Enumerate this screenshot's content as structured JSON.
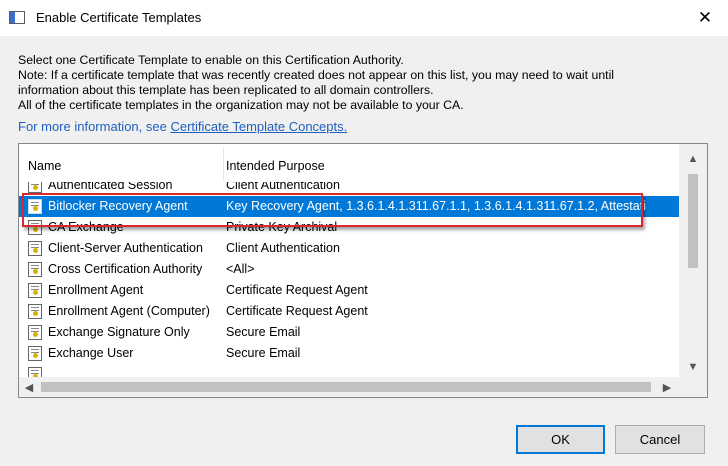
{
  "window": {
    "title": "Enable Certificate Templates",
    "close_glyph": "✕"
  },
  "description": {
    "line1": "Select one Certificate Template to enable on this Certification Authority.",
    "line2": "Note: If a certificate template that was recently created does not appear on this list, you may need to wait until",
    "line3": "information about this template has been replicated to all domain controllers.",
    "line4": "All of the certificate templates in the organization may not be available to your CA.",
    "info_prefix": "For more information, see ",
    "info_link": "Certificate Template Concepts."
  },
  "list": {
    "columns": {
      "name": "Name",
      "purpose": "Intended Purpose"
    },
    "rows": [
      {
        "name": "Authenticated Session",
        "purpose": "Client Authentication"
      },
      {
        "name": "Bitlocker Recovery Agent",
        "purpose": "Key Recovery Agent, 1.3.6.1.4.1.311.67.1.1, 1.3.6.1.4.1.311.67.1.2, Attestati"
      },
      {
        "name": "CA Exchange",
        "purpose": "Private Key Archival"
      },
      {
        "name": "Client-Server Authentication",
        "purpose": "Client Authentication"
      },
      {
        "name": "Cross Certification Authority",
        "purpose": "<All>"
      },
      {
        "name": "Enrollment Agent",
        "purpose": "Certificate Request Agent"
      },
      {
        "name": "Enrollment Agent (Computer)",
        "purpose": "Certificate Request Agent"
      },
      {
        "name": "Exchange Signature Only",
        "purpose": "Secure Email"
      },
      {
        "name": "Exchange User",
        "purpose": "Secure Email"
      }
    ],
    "selected_index": 1
  },
  "scrollbar": {
    "up_glyph": "▲",
    "down_glyph": "▼",
    "left_glyph": "◀",
    "right_glyph": "▶"
  },
  "buttons": {
    "ok": "OK",
    "cancel": "Cancel"
  },
  "colors": {
    "selection": "#0078d7",
    "highlight_box": "#d9282f",
    "link": "#1f5fbf"
  }
}
